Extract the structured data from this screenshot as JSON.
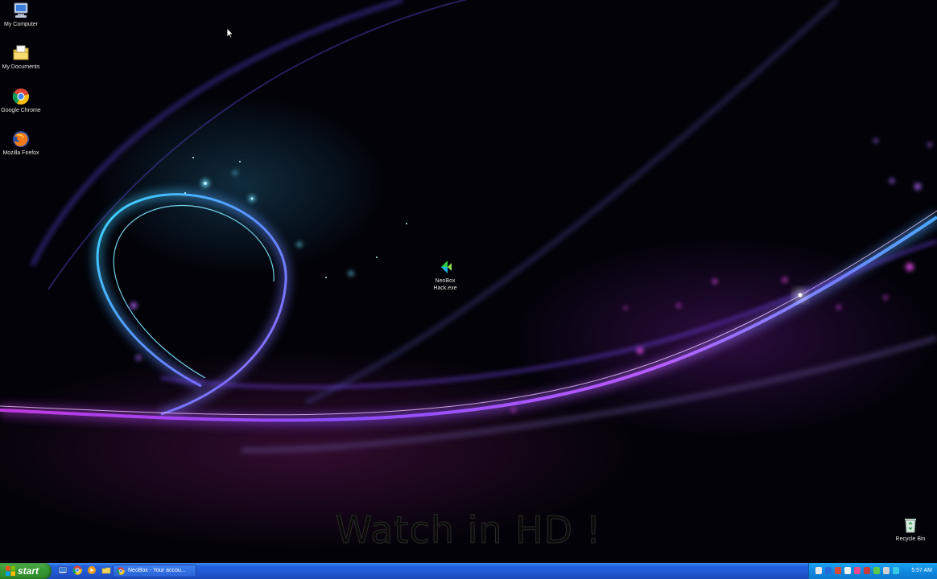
{
  "desktop": {
    "icons": [
      {
        "label": "My Computer",
        "icon": "my-computer-icon"
      },
      {
        "label": "My Documents",
        "icon": "my-documents-icon"
      },
      {
        "label": "Google Chrome",
        "icon": "chrome-icon"
      },
      {
        "label": "Mozilla Firefox",
        "icon": "firefox-icon"
      },
      {
        "label": "NeoBox Hack.exe",
        "icon": "neobox-exe-icon"
      },
      {
        "label": "Recycle Bin",
        "icon": "recycle-bin-icon"
      }
    ],
    "watermark": "Watch in HD !"
  },
  "taskbar": {
    "start_label": "start",
    "quick_launch": [
      "show-desktop-icon",
      "chrome-icon",
      "media-player-icon",
      "explorer-icon"
    ],
    "task_button_label": "NeoBox - Your accou...",
    "tray_icons": [
      "network-icon",
      "bluetooth-icon",
      "security-icon",
      "volume-icon",
      "update-icon",
      "antivirus-icon",
      "chat-icon",
      "usb-icon",
      "clock-sync-icon"
    ],
    "clock": "5:57 AM"
  },
  "colors": {
    "taskbar": "#2157d6",
    "start_button": "#379a33",
    "tray": "#0f8ae0",
    "wallpaper_cyan": "#2ad3ff",
    "wallpaper_purple": "#9b3cff",
    "wallpaper_magenta": "#d43cd8"
  }
}
